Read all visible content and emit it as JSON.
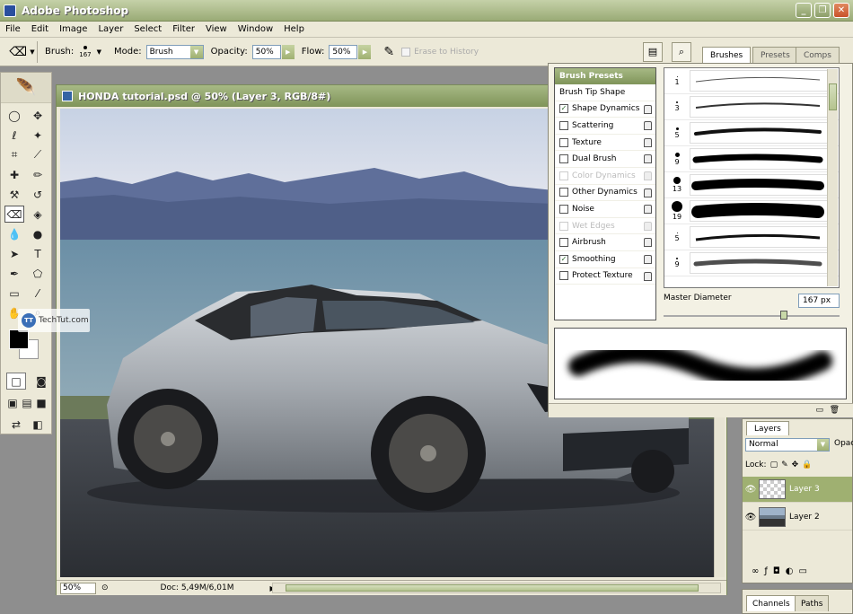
{
  "window": {
    "title": "Adobe Photoshop",
    "buttons": [
      "_",
      "❐",
      "✕"
    ]
  },
  "menu": [
    "File",
    "Edit",
    "Image",
    "Layer",
    "Select",
    "Filter",
    "View",
    "Window",
    "Help"
  ],
  "options": {
    "brush_label": "Brush:",
    "brush_size": "167",
    "mode_label": "Mode:",
    "mode_value": "Brush",
    "opacity_label": "Opacity:",
    "opacity_value": "50%",
    "flow_label": "Flow:",
    "flow_value": "50%",
    "erase_history": "Erase to History"
  },
  "palette_well": {
    "tabs": [
      "Brushes",
      "Presets",
      "Comps"
    ]
  },
  "document": {
    "title": "HONDA tutorial.psd @ 50% (Layer 3, RGB/8#)",
    "zoom": "50%",
    "doc_size": "Doc: 5,49M/6,01M"
  },
  "brushes_panel": {
    "header": "Brush Presets",
    "tip_shape": "Brush Tip Shape",
    "items": [
      {
        "label": "Shape Dynamics",
        "checked": true,
        "disabled": false
      },
      {
        "label": "Scattering",
        "checked": false,
        "disabled": false
      },
      {
        "label": "Texture",
        "checked": false,
        "disabled": false
      },
      {
        "label": "Dual Brush",
        "checked": false,
        "disabled": false
      },
      {
        "label": "Color Dynamics",
        "checked": false,
        "disabled": true
      },
      {
        "label": "Other Dynamics",
        "checked": false,
        "disabled": false
      },
      {
        "label": "Noise",
        "checked": false,
        "disabled": false
      },
      {
        "label": "Wet Edges",
        "checked": false,
        "disabled": true
      },
      {
        "label": "Airbrush",
        "checked": false,
        "disabled": false
      },
      {
        "label": "Smoothing",
        "checked": true,
        "disabled": false
      },
      {
        "label": "Protect Texture",
        "checked": false,
        "disabled": false
      }
    ],
    "stroke_sizes": [
      "1",
      "3",
      "5",
      "9",
      "13",
      "19",
      "5",
      "9"
    ],
    "master_diameter_label": "Master Diameter",
    "master_diameter_value": "167 px"
  },
  "layers_panel": {
    "tab": "Layers",
    "blend": "Normal",
    "opacity_label": "Opac",
    "lock_label": "Lock:",
    "layers": [
      {
        "name": "Layer 3",
        "selected": true
      },
      {
        "name": "Layer 2",
        "selected": false
      }
    ]
  },
  "channels_panel": {
    "tabs": [
      "Channels",
      "Paths"
    ]
  },
  "watermark": {
    "logo": "TT",
    "text": "TechTut.com"
  },
  "colors": {
    "accent": "#9fb071",
    "title_green": "#7f9459"
  }
}
